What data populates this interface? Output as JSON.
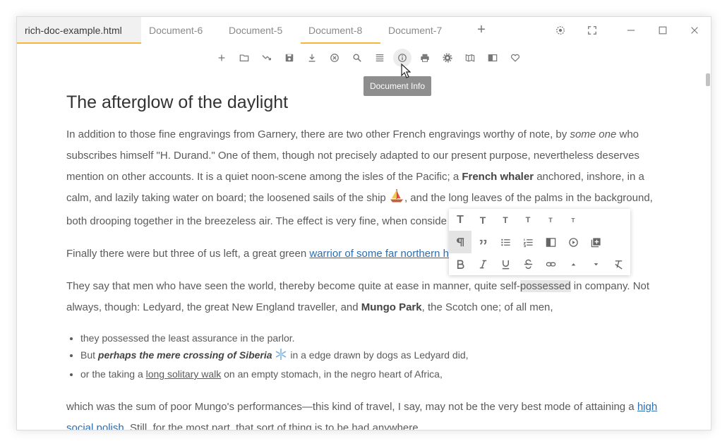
{
  "tabs": [
    {
      "label": "rich-doc-example.html",
      "state": "active"
    },
    {
      "label": "Document-6",
      "state": "normal"
    },
    {
      "label": "Document-5",
      "state": "normal"
    },
    {
      "label": "Document-8",
      "state": "highlighted"
    },
    {
      "label": "Document-7",
      "state": "normal"
    }
  ],
  "new_tab_icon": "plus-icon",
  "window_controls": [
    "settings-icon",
    "fullscreen-icon",
    "minimize-icon",
    "maximize-icon",
    "close-icon"
  ],
  "toolbar_icons": [
    "plus-icon",
    "folder-icon",
    "route-icon",
    "save-icon",
    "download-icon",
    "close-circle-icon",
    "search-icon",
    "menu-icon",
    "info-icon",
    "print-icon",
    "gear-icon",
    "map-icon",
    "book-icon",
    "heart-icon"
  ],
  "tooltip": "Document Info",
  "doc": {
    "title": "The afterglow of the daylight",
    "p1": {
      "t1": "In addition to those fine engravings from Garnery, there are two other French engravings worthy of note, by ",
      "em1": "some one",
      "t2": " who subscribes himself \"H. Durand.\" One of them, though not precisely adapted to our present purpose, nevertheless deserves mention on other accounts. It is a quiet noon-scene among the isles of the Pacific; a ",
      "b1": "French whaler",
      "t3": " anchored, inshore, in a calm, and lazily taking water on board; the loosened sails of the ship ",
      "t4": ", and the long leaves of the palms in the background, both drooping together in the breezeless air. The effect is very fine, when conside"
    },
    "p2": {
      "t1": "Finally there were but three of us left, a great green ",
      "link": "warrior of some far northern ho"
    },
    "p3": {
      "t1": "They say that men who have seen the world, thereby become quite at ease in manner, quite self-",
      "hl": "possessed",
      "t2": " in company. Not always, though: Ledyard, the great New England traveller, and ",
      "b1": "Mungo Park",
      "t3": ", the Scotch one; of all men,"
    },
    "list": {
      "i1": "they possessed the least assurance in the parlor.",
      "i2_pre": "But ",
      "i2_em": "perhaps the mere crossing of Siberia",
      "i2_post": " in a edge drawn by dogs as Ledyard did,",
      "i3_pre": "or the taking a ",
      "i3_u": "long solitary walk",
      "i3_post": " on an empty stomach, in the negro heart of Africa,"
    },
    "p4": {
      "t1": "which was the sum of poor Mungo's performances—this kind of travel, I say, may not be the very best mode of attaining a ",
      "link": "high social polish",
      "t2": ". Still, ",
      "u1": "for the most part",
      "t3": ", that sort of thing is to be had anywhere."
    }
  },
  "format_toolbar": {
    "headings": [
      "T",
      "T",
      "T",
      "T",
      "T",
      "T"
    ],
    "active_block": "paragraph"
  },
  "colors": {
    "accent": "#f4b73c",
    "link": "#2a6db4",
    "text": "#5a5a5a"
  }
}
